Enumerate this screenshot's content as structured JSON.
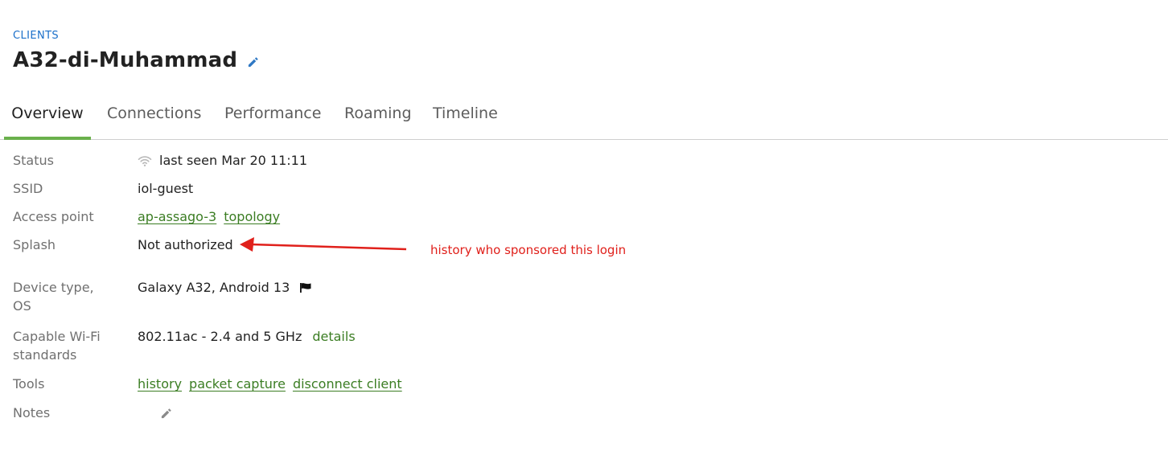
{
  "breadcrumb": {
    "label": "CLIENTS"
  },
  "header": {
    "title": "A32-di-Muhammad",
    "edit_icon": "pencil-icon"
  },
  "tabs": [
    {
      "label": "Overview",
      "active": true
    },
    {
      "label": "Connections",
      "active": false
    },
    {
      "label": "Performance",
      "active": false
    },
    {
      "label": "Roaming",
      "active": false
    },
    {
      "label": "Timeline",
      "active": false
    }
  ],
  "details": {
    "status": {
      "label": "Status",
      "value": "last seen Mar 20 11:11",
      "icon": "wifi-icon"
    },
    "ssid": {
      "label": "SSID",
      "value": "iol-guest"
    },
    "access_point": {
      "label": "Access point",
      "ap_link": "ap-assago-3",
      "topology_link": "topology"
    },
    "splash": {
      "label": "Splash",
      "value": "Not authorized"
    },
    "device": {
      "label_line1": "Device type,",
      "label_line2": "OS",
      "value": "Galaxy A32, Android 13",
      "icon": "flag-icon"
    },
    "wifi_standards": {
      "label_line1": "Capable Wi-Fi",
      "label_line2": "standards",
      "value": "802.11ac - 2.4 and 5 GHz",
      "details_link": "details"
    },
    "tools": {
      "label": "Tools",
      "links": [
        "history",
        "packet capture",
        "disconnect client"
      ]
    },
    "notes": {
      "label": "Notes",
      "icon": "pencil-icon"
    }
  },
  "annotation": {
    "text": "history who sponsored this login",
    "color": "#e0201b"
  },
  "colors": {
    "accent_green": "#6ab04c",
    "link_green": "#3b7d23",
    "breadcrumb_blue": "#1a6fc9"
  }
}
